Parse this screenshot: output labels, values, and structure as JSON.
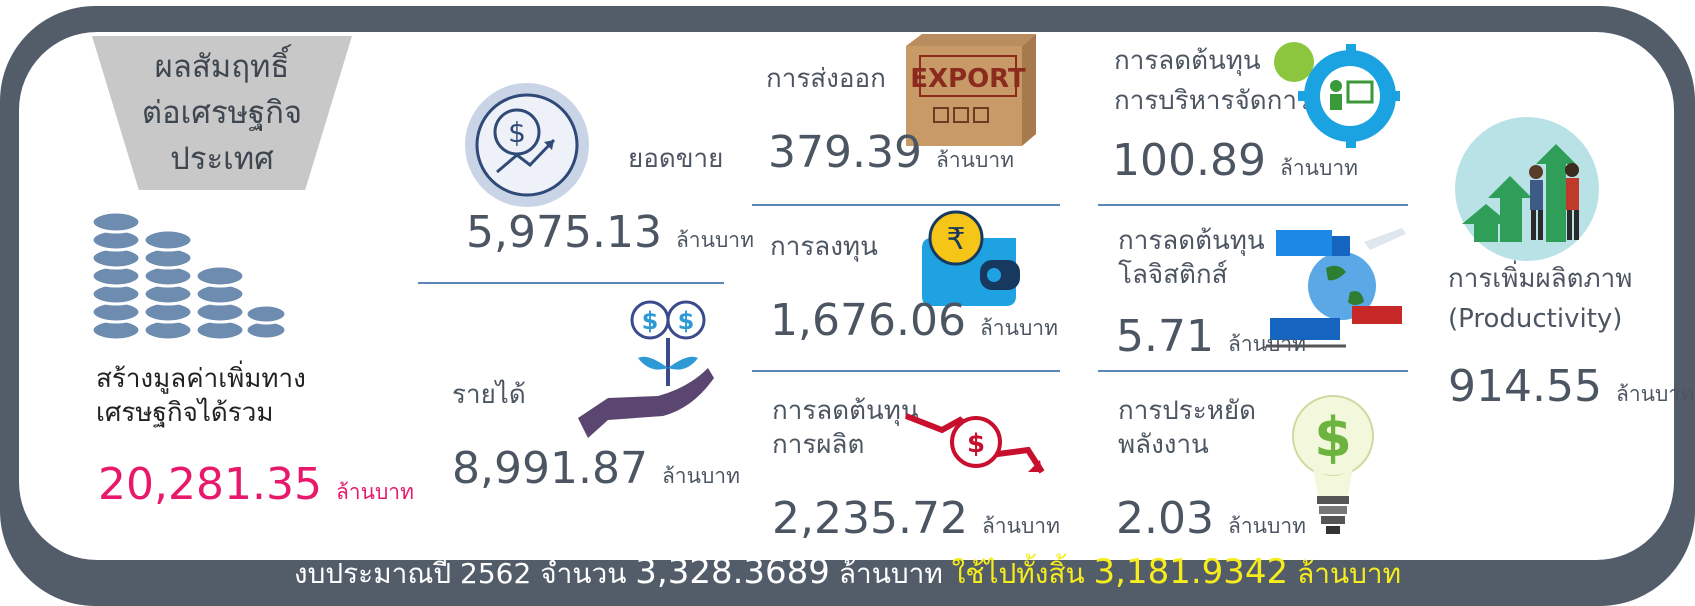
{
  "heading": [
    "ผลสัมฤทธิ์",
    "ต่อเศรษฐกิจ",
    "ประเทศ"
  ],
  "unit": "ล้านบาท",
  "total": {
    "label_lines": [
      "สร้างมูลค่าเพิ่มทาง",
      "เศรษฐกิจได้รวม"
    ],
    "value": "20,281.35"
  },
  "sales": {
    "label": "ยอดขาย",
    "value": "5,975.13"
  },
  "income": {
    "label": "รายได้",
    "value": "8,991.87"
  },
  "export": {
    "label": "การส่งออก",
    "value": "379.39",
    "box_text": "EXPORT"
  },
  "investment": {
    "label": "การลงทุน",
    "value": "1,676.06",
    "coin_symbol": "₹"
  },
  "production_cost": {
    "label_lines": [
      "การลดต้นทุน",
      "การผลิต"
    ],
    "value": "2,235.72"
  },
  "admin_cost": {
    "label_lines": [
      "การลดต้นทุน",
      "การบริหารจัดการ"
    ],
    "value": "100.89"
  },
  "logistics_cost": {
    "label_lines": [
      "การลดต้นทุน",
      "โลจิสติกส์"
    ],
    "value": "5.71"
  },
  "energy": {
    "label_lines": [
      "การประหยัด",
      "พลังงาน"
    ],
    "value": "2.03"
  },
  "productivity": {
    "label_lines": [
      "การเพิ่มผลิตภาพ",
      "(Productivity)"
    ],
    "value": "914.55"
  },
  "footer": {
    "part1": "งบประมาณปี 2562 จำนวน",
    "budget": "3,328.3689",
    "unit1": "ล้านบาท",
    "part2": "ใช้ไปทั้งสิ้น",
    "spent": "3,181.9342",
    "unit2": "ล้านบาท"
  },
  "colors": {
    "frame": "#535d6a",
    "text": "#4c5562",
    "accent_pink": "#e8196a",
    "divider": "#5b86b5",
    "footer_highlight": "#f7ec1c"
  },
  "icons": [
    "coin-stack-icon",
    "dollar-growth-icon",
    "money-plant-icon",
    "export-box-icon",
    "wallet-icon",
    "cost-down-icon",
    "gear-presentation-icon",
    "logistics-icon",
    "lightbulb-dollar-icon",
    "productivity-icon"
  ]
}
